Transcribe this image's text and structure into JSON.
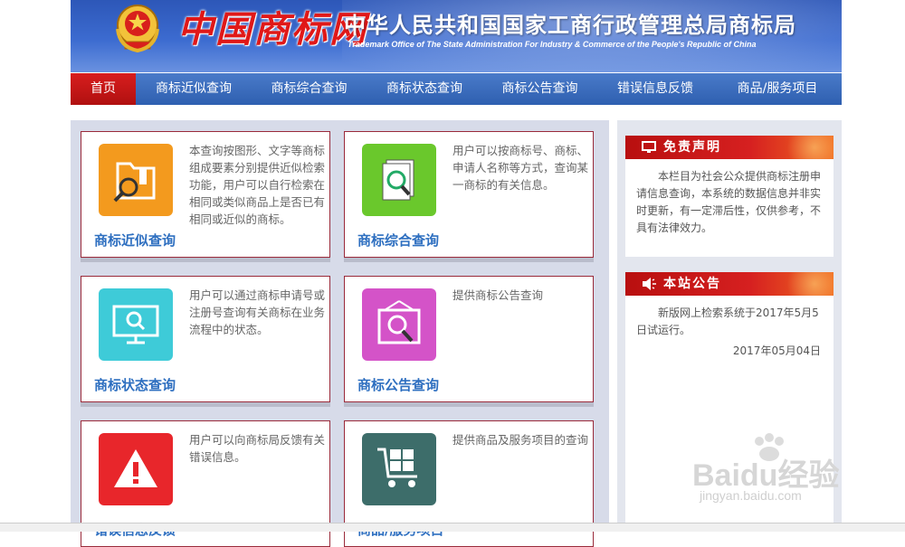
{
  "header": {
    "logo_text": "中国商标网",
    "title": "中华人民共和国国家工商行政管理总局商标局",
    "subtitle": "Trademark Office of The State Administration For Industry & Commerce of the People's Republic of China"
  },
  "nav": {
    "items": [
      {
        "label": "首页"
      },
      {
        "label": "商标近似查询"
      },
      {
        "label": "商标综合查询"
      },
      {
        "label": "商标状态查询"
      },
      {
        "label": "商标公告查询"
      },
      {
        "label": "错误信息反馈"
      },
      {
        "label": "商品/服务项目"
      }
    ]
  },
  "cards": [
    {
      "title": "商标近似查询",
      "desc": "本查询按图形、文字等商标组成要素分别提供近似检索功能，用户可以自行检索在相同或类似商品上是否已有相同或近似的商标。",
      "color": "#f39a1e",
      "icon": "folder-search-icon"
    },
    {
      "title": "商标综合查询",
      "desc": "用户可以按商标号、商标、申请人名称等方式，查询某一商标的有关信息。",
      "color": "#6ac82c",
      "icon": "document-search-icon"
    },
    {
      "title": "商标状态查询",
      "desc": "用户可以通过商标申请号或注册号查询有关商标在业务流程中的状态。",
      "color": "#3ecbd8",
      "icon": "monitor-search-icon"
    },
    {
      "title": "商标公告查询",
      "desc": "提供商标公告查询",
      "color": "#d453c8",
      "icon": "frame-search-icon"
    },
    {
      "title": "错误信息反馈",
      "desc": "用户可以向商标局反馈有关错误信息。",
      "color": "#e8262b",
      "icon": "warning-icon"
    },
    {
      "title": "商品/服务项目",
      "desc": "提供商品及服务项目的查询",
      "color": "#3d6d6a",
      "icon": "cart-icon"
    }
  ],
  "side": {
    "disclaimer": {
      "title": "免责声明",
      "body": "本栏目为社会公众提供商标注册申请信息查询，本系统的数据信息并非实时更新，有一定滞后性，仅供参考，不具有法律效力。"
    },
    "notice": {
      "title": "本站公告",
      "body": "新版网上检索系统于2017年5月5日试运行。",
      "date": "2017年05月04日"
    }
  },
  "watermark": {
    "text": "Baidu经验",
    "url": "jingyan.baidu.com"
  }
}
